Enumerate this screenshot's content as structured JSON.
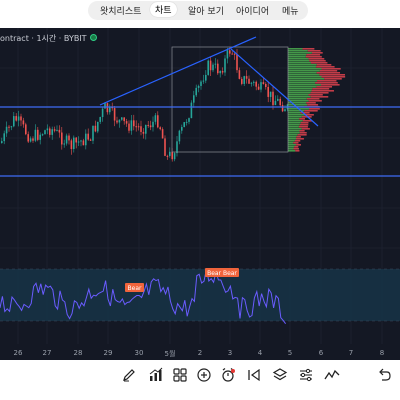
{
  "nav": {
    "tabs": [
      {
        "label": "왓치리스트",
        "active": false
      },
      {
        "label": "차트",
        "active": true
      },
      {
        "label": "알아 보기",
        "active": false
      },
      {
        "label": "아이디어",
        "active": false
      },
      {
        "label": "메뉴",
        "active": false
      }
    ]
  },
  "chart": {
    "symbol_text": "ontract · 1시간 · BYBIT",
    "rsi_labels": [
      "Bear",
      "Bear Bear"
    ],
    "x_ticks": [
      "26",
      "27",
      "28",
      "29",
      "30",
      "5월",
      "2",
      "3",
      "4",
      "5",
      "6",
      "7",
      "8"
    ],
    "colors": {
      "background": "#141824",
      "up_candle": "#26a69a",
      "down_candle": "#ef5350",
      "trendline": "#2962ff",
      "horizontal_line": "#3d6cf5",
      "rsi_line": "#6a5cff",
      "rsi_band": "#163446",
      "bear_label": "#f0643c",
      "profile_up": "#4caf50",
      "profile_down": "#e0434f"
    }
  },
  "toolbar": {
    "icons": [
      "pencil-icon",
      "bar-chart-icon",
      "grid-icon",
      "add-circle-icon",
      "alarm-icon",
      "step-back-icon",
      "layers-icon",
      "settings-sliders-icon",
      "zigzag-icon",
      "undo-icon"
    ]
  }
}
